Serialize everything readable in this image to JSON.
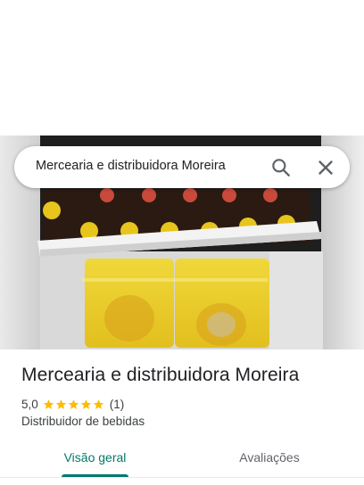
{
  "search": {
    "query": "Mercearia e distribuidora Moreira"
  },
  "place": {
    "name": "Mercearia e distribuidora Moreira",
    "rating": "5,0",
    "rating_count": "(1)",
    "stars": 5,
    "category": "Distribuidor de bebidas"
  },
  "tabs": [
    {
      "label": "Visão geral",
      "active": true
    },
    {
      "label": "Avaliações",
      "active": false
    }
  ],
  "colors": {
    "accent": "#00796b",
    "star": "#fbbc04"
  },
  "icons": {
    "search": "search-icon",
    "close": "close-icon"
  }
}
